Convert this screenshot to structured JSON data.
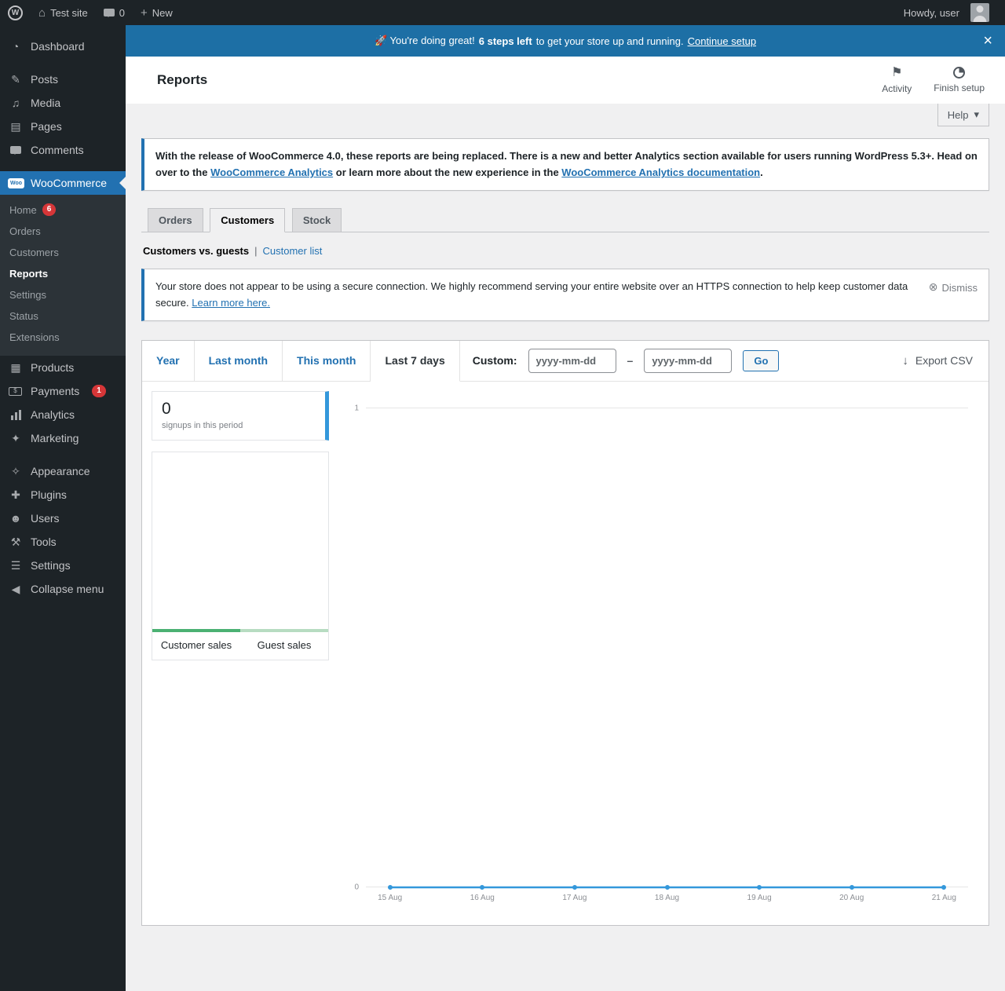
{
  "colors": {
    "accent": "#2271b1",
    "banner_bg": "#1d6fa5",
    "badge": "#d63638",
    "signups": "#3498db",
    "legend_customer": "#4bb173",
    "legend_guest": "#b7dcc1"
  },
  "icons": {
    "wordpress": "W",
    "site": "⌂",
    "plus": "+",
    "dashboard": "◔",
    "posts": "✎",
    "media": "♫",
    "pages": "▤",
    "woocommerce": "Woo",
    "products": "▦",
    "payments": "$",
    "marketing": "✦",
    "appearance": "✧",
    "plugins": "✚",
    "users": "☻",
    "tools": "⚒",
    "settings": "☰",
    "collapse": "◀",
    "activity_flag": "⚑",
    "export_arrow": "↓",
    "dismiss": "⊗",
    "close": "×",
    "help_chevron": "▾"
  },
  "admin_bar": {
    "site_name": "Test site",
    "comments_count": "0",
    "new_label": "New",
    "howdy": "Howdy, user"
  },
  "sidebar": {
    "dashboard": "Dashboard",
    "posts": "Posts",
    "media": "Media",
    "pages": "Pages",
    "comments": "Comments",
    "woocommerce": "WooCommerce",
    "woo": {
      "home": "Home",
      "home_badge": "6",
      "orders": "Orders",
      "customers": "Customers",
      "reports": "Reports",
      "settings": "Settings",
      "status": "Status",
      "extensions": "Extensions"
    },
    "products": "Products",
    "payments": "Payments",
    "payments_badge": "1",
    "analytics": "Analytics",
    "marketing": "Marketing",
    "appearance": "Appearance",
    "plugins": "Plugins",
    "users": "Users",
    "tools": "Tools",
    "settings": "Settings",
    "collapse": "Collapse menu"
  },
  "banner": {
    "pre": "🚀 You're doing great!",
    "bold": "6 steps left",
    "post": "to get your store up and running.",
    "link": "Continue setup"
  },
  "header": {
    "title": "Reports",
    "activity": "Activity",
    "finish_setup": "Finish setup"
  },
  "help": {
    "label": "Help"
  },
  "analytics_notice": {
    "text1": "With the release of WooCommerce 4.0, these reports are being replaced. There is a new and better Analytics section available for users running WordPress 5.3+. Head on over to the",
    "link1": "WooCommerce Analytics",
    "text2": "or learn more about the new experience in the",
    "link2": "WooCommerce Analytics documentation",
    "text3": "."
  },
  "tabs": {
    "orders": "Orders",
    "customers": "Customers",
    "stock": "Stock"
  },
  "subnav": {
    "current": "Customers vs. guests",
    "separator": "|",
    "link": "Customer list"
  },
  "secure_notice": {
    "text": "Your store does not appear to be using a secure connection. We highly recommend serving your entire website over an HTTPS connection to help keep customer data secure.",
    "link": "Learn more here.",
    "dismiss": "Dismiss"
  },
  "report": {
    "ranges": {
      "year": "Year",
      "last_month": "Last month",
      "this_month": "This month",
      "last_7_days": "Last 7 days"
    },
    "custom_label": "Custom:",
    "date_placeholder": "yyyy-mm-dd",
    "range_separator": "–",
    "go": "Go",
    "export_csv": "Export CSV",
    "signups_value": "0",
    "signups_caption": "signups in this period",
    "legend": {
      "customer": "Customer sales",
      "guest": "Guest sales"
    }
  },
  "chart_data": {
    "type": "line",
    "title": "Customers vs. guests — Last 7 days",
    "x": [
      "15 Aug",
      "16 Aug",
      "17 Aug",
      "18 Aug",
      "19 Aug",
      "20 Aug",
      "21 Aug"
    ],
    "series": [
      {
        "name": "Signups in this period",
        "color": "#3498db",
        "values": [
          0,
          0,
          0,
          0,
          0,
          0,
          0
        ]
      }
    ],
    "ylim": [
      0,
      1
    ],
    "yticks": [
      0,
      1
    ],
    "grid": true,
    "legend_position": "sidebar"
  }
}
